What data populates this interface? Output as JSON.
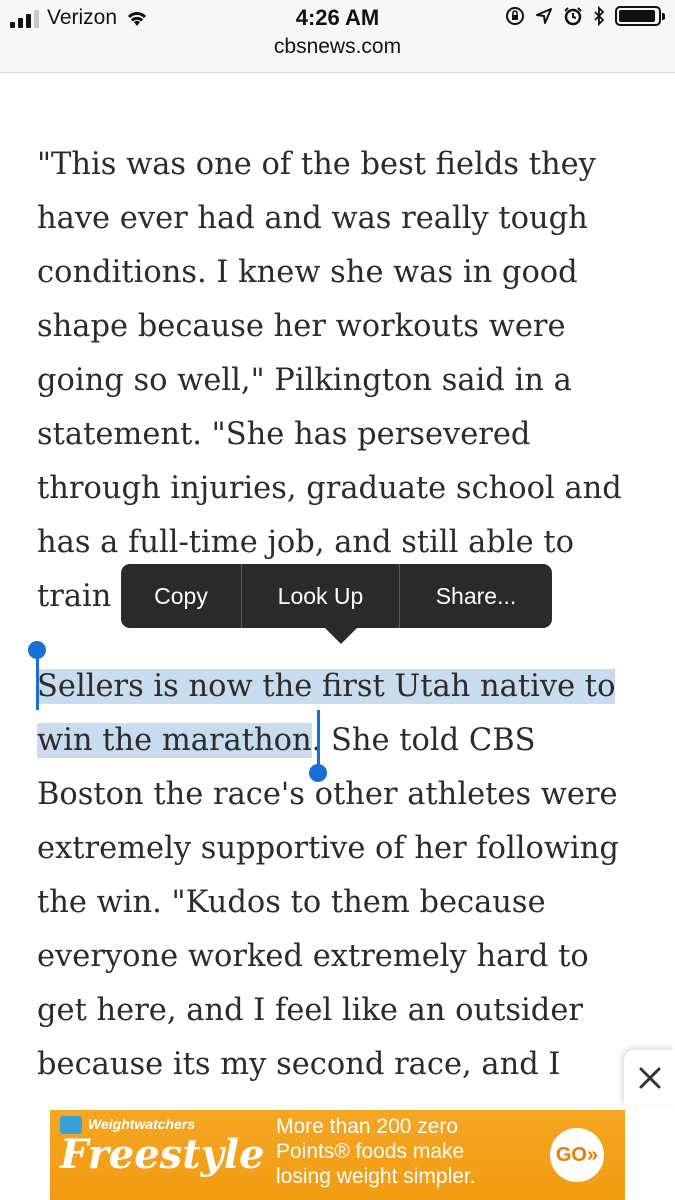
{
  "status_bar": {
    "carrier": "Verizon",
    "time": "4:26 AM",
    "url": "cbsnews.com",
    "icons": [
      "signal-bars-icon",
      "wifi-icon",
      "orientation-lock-icon",
      "location-arrow-icon",
      "alarm-clock-icon",
      "bluetooth-icon",
      "battery-icon"
    ]
  },
  "article": {
    "para1": "\"This was one of the best fields they have ever had and was really tough conditions. I knew she was in good shape because her workouts were going so well,\" Pilkington said in a statement. \"She has persevered through injuries, graduate school and has a full-time job, and still able to train",
    "para2_selected": "Sellers is now the first Utah native to win the marathon",
    "para2_rest": ". She told CBS Boston the race's other athletes were extremely supportive of her following the win. \"Kudos to them because everyone worked extremely hard to get here, and I feel like an outsider because its my second race, and I"
  },
  "callout_menu": {
    "copy": "Copy",
    "look_up": "Look Up",
    "share": "Share..."
  },
  "ad": {
    "brand_top": "Weightwatchers",
    "brand_main": "Freestyle",
    "line1": "More than 200 zero",
    "line2": "Points® foods make",
    "line3": "losing weight simpler.",
    "cta": "GO»",
    "close_icon": "close-icon"
  },
  "colors": {
    "selection": "#c9dcef",
    "handle": "#1a6fd6",
    "callout_bg": "#2a2a2a",
    "ad_orange": "#f39c12"
  }
}
